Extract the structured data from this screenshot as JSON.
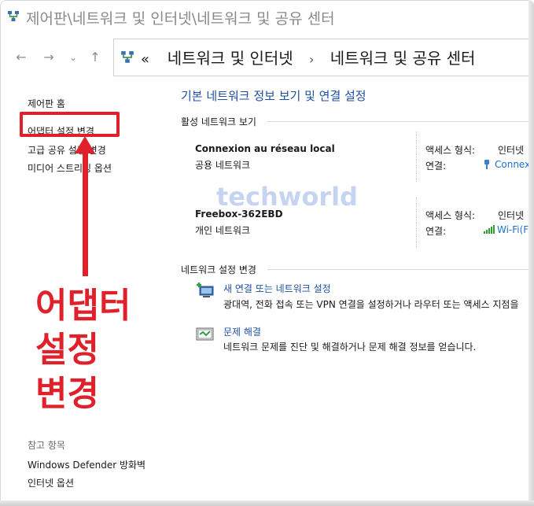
{
  "window": {
    "title": "제어판\\네트워크 및 인터넷\\네트워크 및 공유 센터"
  },
  "nav": {
    "back_icon": "back-arrow-icon",
    "forward_icon": "forward-arrow-icon",
    "recent_icon": "chevron-down-icon",
    "up_icon": "up-arrow-icon",
    "breadcrumb": {
      "overflow": "«",
      "items": [
        "네트워크 및 인터넷",
        "네트워크 및 공유 센터"
      ],
      "separator": "›"
    }
  },
  "sidebar": {
    "items": [
      {
        "label": "제어판 홈"
      },
      {
        "label": "어댑터 설정 변경"
      },
      {
        "label": "고급 공유 설정 변경"
      },
      {
        "label": "미디어 스트리밍 옵션"
      }
    ],
    "see_also_title": "참고 항목",
    "see_also": [
      {
        "label": "Windows Defender 방화벽"
      },
      {
        "label": "인터넷 옵션"
      }
    ]
  },
  "annotation": {
    "lines": [
      "어댑터",
      "설정",
      "변경"
    ],
    "color": "#e0202a"
  },
  "main": {
    "title": "기본 네트워크 정보 보기 및 연결 설정",
    "active_section": "활성 네트워크 보기",
    "networks": [
      {
        "name": "Connexion au réseau local",
        "type": "공용 네트워크",
        "access_label": "액세스 형식:",
        "access_value": "인터넷",
        "conn_label": "연결:",
        "conn_value": "Connexio",
        "conn_icon": "ethernet-icon"
      },
      {
        "name": "Freebox-362EBD",
        "type": "개인 네트워크",
        "access_label": "액세스 형식:",
        "access_value": "인터넷",
        "conn_label": "연결:",
        "conn_value": "Wi-Fi(Fre",
        "conn_icon": "wifi-signal-icon"
      }
    ],
    "change_section": "네트워크 설정 변경",
    "tasks": [
      {
        "link": "새 연결 또는 네트워크 설정",
        "desc": "광대역, 전화 접속 또는 VPN 연결을 설정하거나 라우터 또는 액세스 지점을",
        "icon": "new-connection-icon"
      },
      {
        "link": "문제 해결",
        "desc": "네트워크 문제를 진단 및 해결하거나 문제 해결 정보를 얻습니다.",
        "icon": "troubleshoot-icon"
      }
    ]
  },
  "watermark": "techworld",
  "colors": {
    "link": "#1e4fa3",
    "accent_red": "#e0202a"
  }
}
